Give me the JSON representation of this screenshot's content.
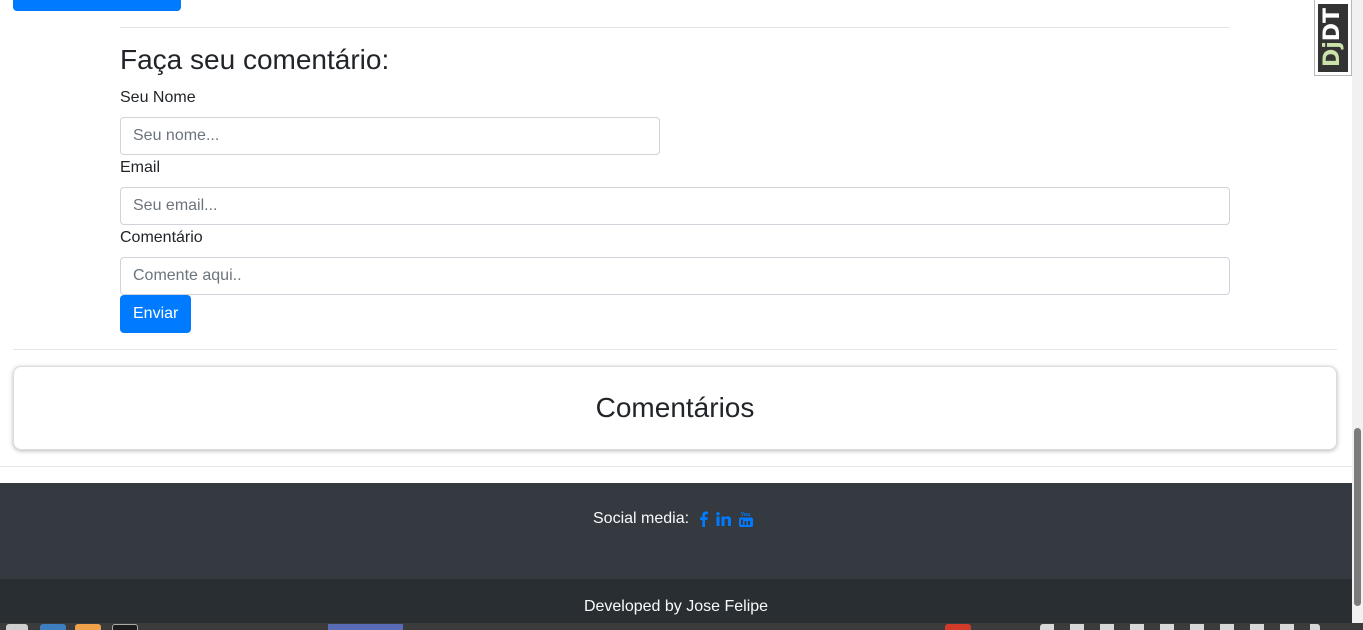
{
  "form": {
    "title": "Faça seu comentário:",
    "name_label": "Seu Nome",
    "name_placeholder": "Seu nome...",
    "email_label": "Email",
    "email_placeholder": "Seu email...",
    "comment_label": "Comentário",
    "comment_placeholder": "Comente aqui..",
    "submit_label": "Enviar"
  },
  "comments": {
    "title": "Comentários"
  },
  "footer": {
    "social_label": "Social media:",
    "social_icons": [
      "facebook-icon",
      "linkedin-icon",
      "youtube-icon"
    ],
    "credit": "Developed by Jose Felipe"
  },
  "debug_toolbar": {
    "label_dj": "Dj",
    "label_dt": "DT"
  },
  "colors": {
    "primary": "#007bff",
    "footer_dark": "#343a40",
    "footer_darker": "#292e33"
  }
}
